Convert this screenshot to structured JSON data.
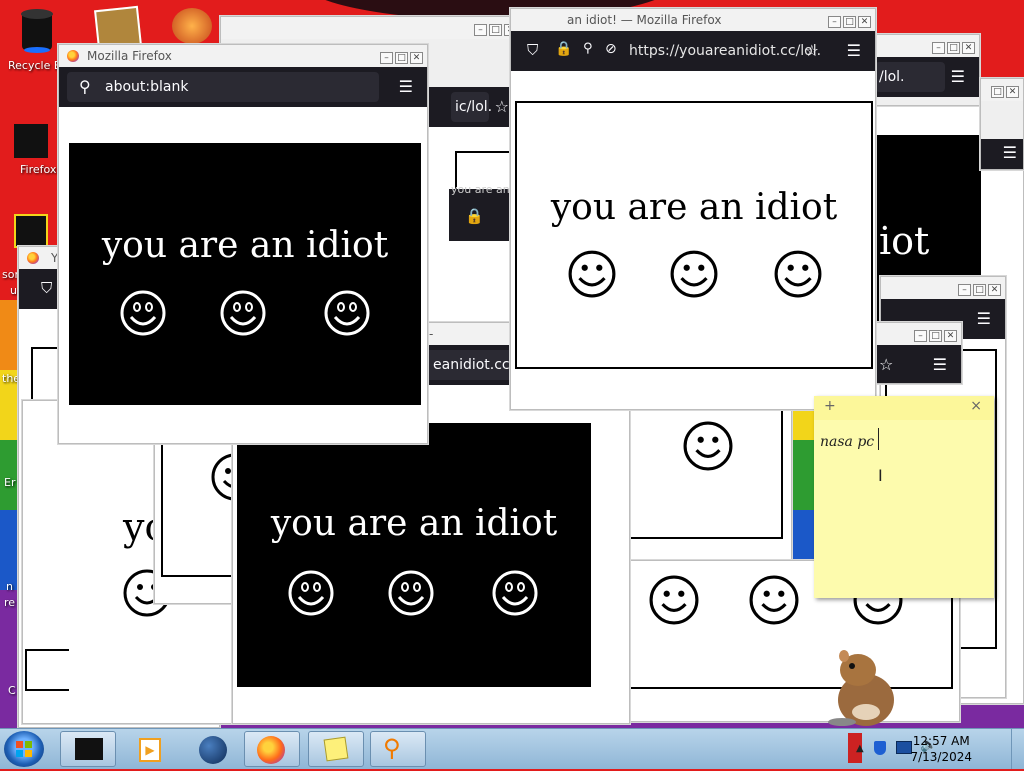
{
  "desktop": {
    "icons": [
      {
        "label": "Recycle B",
        "icon": "recycle-bin-icon"
      },
      {
        "label": "Firefox",
        "icon": "firefox-icon"
      }
    ],
    "edge_labels": [
      "son",
      "u",
      "the",
      "Er",
      "n",
      "re",
      "C"
    ]
  },
  "windows": {
    "main_title": "Mozilla Firefox",
    "main_url": "about:blank",
    "top_title": "an idiot! — Mozilla Firefox",
    "top_url": "https://youareanidiot.cc/lol.",
    "mid_url": "eanidiot.cc/lol.",
    "right_url_fragment": "/lol.",
    "behind_url_fragment": "ic/lol.",
    "behind_tab_text": "you are an",
    "behind_title_fragment": "Y",
    "message": "you are an idiot",
    "partial_message_left": "yo",
    "partial_message_right": "an",
    "partial_message_far": "iot"
  },
  "sticky_note": {
    "text": "nasa pc",
    "add_label": "+",
    "close_label": "×"
  },
  "taskbar": {
    "time": "12:57 AM",
    "date": "7/13/2024",
    "buttons": [
      "terminal-app",
      "media-player-app",
      "globe-app",
      "firefox-app",
      "sticky-notes-app",
      "search-app"
    ]
  },
  "colors": {
    "taskbar": "#a9c6e0",
    "browser_toolbar": "#1c1b22",
    "sticky": "#fdfbad"
  }
}
